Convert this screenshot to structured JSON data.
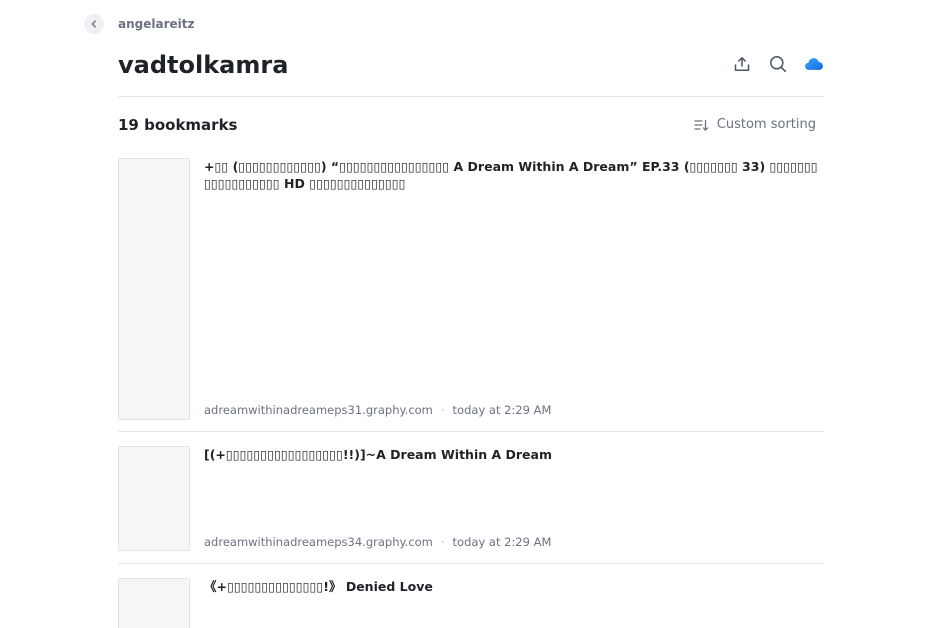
{
  "breadcrumb": {
    "owner": "angelareitz"
  },
  "header": {
    "title": "vadtolkamra"
  },
  "toolbar": {
    "share_icon": "upload-icon",
    "search_icon": "search-icon",
    "cloud_icon": "cloud-icon",
    "cloud_color": "#1f8ef1"
  },
  "summary": {
    "count_label": "19 bookmarks",
    "sort_label": "Custom sorting"
  },
  "bookmarks": [
    {
      "title": "+▯▯ (▯▯▯▯▯▯▯▯▯▯▯▯) “▯▯▯▯▯▯▯▯▯▯▯▯▯▯▯▯ A Dream Within A Dream” EP.33 (▯▯▯▯▯▯▯ 33) ▯▯▯▯▯▯▯ ▯▯▯▯▯▯▯▯▯▯▯ HD ▯▯▯▯▯▯▯▯▯▯▯▯▯▯",
      "domain": "adreamwithinadreameps31.graphy.com",
      "time": "today at 2:29 AM"
    },
    {
      "title": "[(+▯▯▯▯▯▯▯▯▯▯▯▯▯▯▯▯▯!!)]~A Dream Within A Dream",
      "domain": "adreamwithinadreameps34.graphy.com",
      "time": "today at 2:29 AM"
    },
    {
      "title": "《+▯▯▯▯▯▯▯▯▯▯▯▯▯▯!》 Denied Love",
      "domain": "",
      "time": ""
    }
  ]
}
